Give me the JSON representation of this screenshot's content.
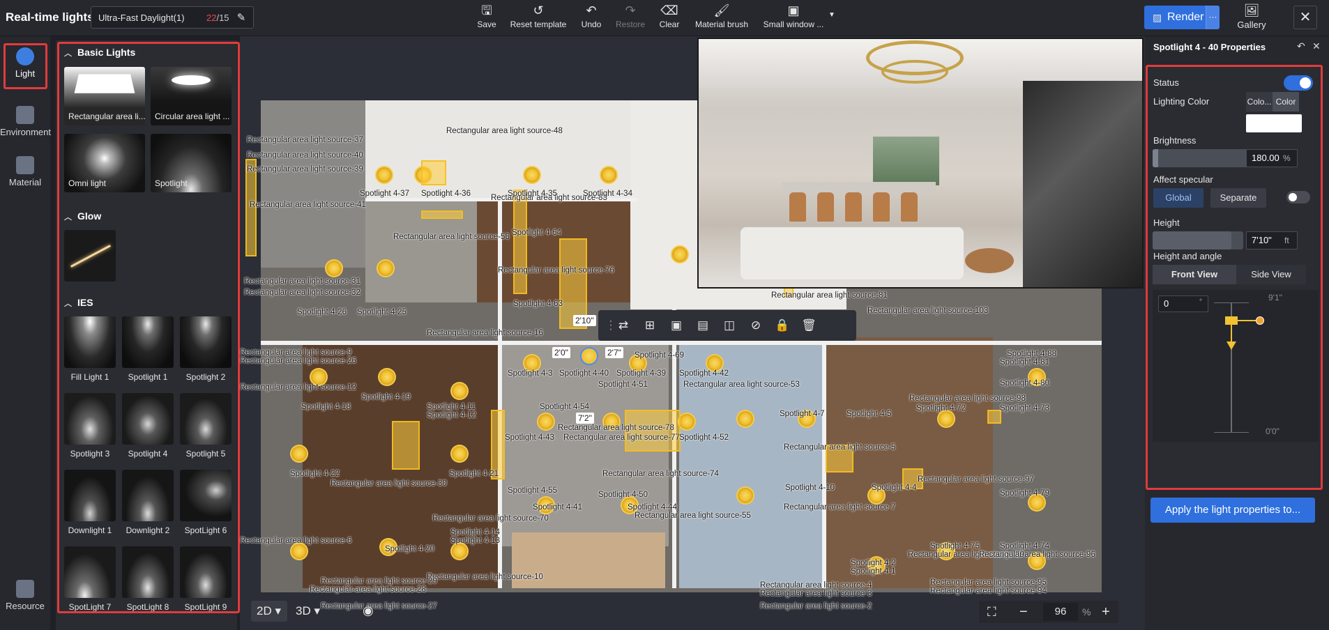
{
  "app": {
    "title": "Real-time lights"
  },
  "template": {
    "name": "Ultra-Fast Daylight(1)",
    "count_current": "22",
    "count_total": "/15"
  },
  "toolbar": {
    "save": "Save",
    "reset": "Reset template",
    "undo": "Undo",
    "restore": "Restore",
    "clear": "Clear",
    "brush": "Material brush",
    "small_window": "Small window ..."
  },
  "render": {
    "label": "Render",
    "more": "···"
  },
  "gallery": {
    "label": "Gallery"
  },
  "leftnav": {
    "light": "Light",
    "environment": "Environment",
    "material": "Material",
    "resource": "Resource"
  },
  "library": {
    "basic_title": "Basic Lights",
    "basic": [
      "Rectangular area li...",
      "Circular area light ...",
      "Omni light",
      "Spotlight"
    ],
    "glow_title": "Glow",
    "ies_title": "IES",
    "ies": [
      "Fill Light 1",
      "Spotlight 1",
      "Spotlight 2",
      "Spotlight 3",
      "Spotlight 4",
      "Spotlight 5",
      "Downlight 1",
      "Downlight 2",
      "SpotLight 6",
      "SpotLight 7",
      "SpotLight 8",
      "SpotLight 9"
    ]
  },
  "plan_labels": [
    "Rectangular area light source-37",
    "Rectangular area light source-40",
    "Rectangular area light source-39",
    "Rectangular area light source-41",
    "Rectangular area light source-48",
    "Rectangular area light source-83",
    "Spotlight 4-37",
    "Spotlight 4-36",
    "Spotlight 4-35",
    "Spotlight 4-34",
    "Spotlight 4-64",
    "Rectangular area light source-56",
    "Rectangular area light source-76",
    "Rectangular area light source-31",
    "Rectangular area light source-32",
    "Spotlight 4-26",
    "Spotlight 4-25",
    "Spotlight 4-63",
    "Rectangular area light source-16",
    "Rectangular area light source-81",
    "Rectangular area light source-103",
    "Rectangular area light source-9",
    "Rectangular area light source-26",
    "Rectangular area light source-12",
    "Spotlight 4-19",
    "Spotlight 4-18",
    "Spotlight 4-11",
    "Spotlight 4-12",
    "Spotlight 4-3",
    "Spotlight 4-40",
    "Spotlight 4-39",
    "Spotlight 4-42",
    "Spotlight 4-69",
    "Spotlight 4-51",
    "Spotlight 4-54",
    "Rectangular area light source-53",
    "Rectangular area light source-78",
    "Rectangular area light source-77",
    "Spotlight 4-52",
    "Spotlight 4-43",
    "Spotlight 4-7",
    "Spotlight 4-5",
    "Spotlight 4-72",
    "Spotlight 4-73",
    "Spotlight 4-81",
    "Spotlight 4-80",
    "Spotlight 4-88",
    "Rectangular area light source-98",
    "Rectangular area light source-5",
    "Spotlight 4-22",
    "Spotlight 4-21",
    "Rectangular area light source-30",
    "Rectangular area light source-74",
    "Spotlight 4-10",
    "Spotlight 4-4",
    "Spotlight 4-55",
    "Spotlight 4-50",
    "Spotlight 4-41",
    "Spotlight 4-44",
    "Rectangular area light source-55",
    "Rectangular area light source-7",
    "Rectangular area light source-97",
    "Spotlight 4-79",
    "Rectangular area light source-70",
    "Spotlight 4-14",
    "Spotlight 4-13",
    "Rectangular area light source-6",
    "Spotlight 4-20",
    "Rectangular area light source-10",
    "Rectangular area light source-29",
    "Rectangular area light source-28",
    "Rectangular area light source-27",
    "Spotlight 4-2",
    "Spotlight 4-1",
    "Rectangular area light source-4",
    "Rectangular area light source-3",
    "Rectangular area light source-2",
    "Spotlight 4-75",
    "Spotlight 4-74",
    "Rectangular area light source-99",
    "Rectangular area light source-96",
    "Rectangular area light source-95",
    "Rectangular area light source-94"
  ],
  "dimensions": {
    "top": "2'10\"",
    "left": "2'0\"",
    "right": "2'7\"",
    "bottom": "7'2\""
  },
  "view": {
    "mode_2d": "2D",
    "mode_3d": "3D",
    "zoom": "96",
    "zoom_unit": "%"
  },
  "properties": {
    "title": "Spotlight 4 - 40 Properties",
    "status_label": "Status",
    "status_on": true,
    "lighting_color_label": "Lighting Color",
    "color_tab_1": "Colo...",
    "color_tab_2": "Color",
    "color_value": "#ffffff",
    "brightness_label": "Brightness",
    "brightness_value": "180.00",
    "brightness_unit": "%",
    "brightness_level": 0.05,
    "specular_label": "Affect specular",
    "specular_global": "Global",
    "specular_separate": "Separate",
    "specular_toggle_on": false,
    "height_label": "Height",
    "height_value": "7'10\"",
    "height_unit": "ft",
    "height_level": 0.87,
    "angle_label": "Height and angle",
    "front_view": "Front View",
    "side_view": "Side View",
    "angle_value": "0",
    "angle_unit": "°",
    "scale_top": "9'1\"",
    "scale_bottom": "0'0\""
  },
  "apply_button": "Apply the light properties to...",
  "colors": {
    "accent": "#2f6fde",
    "highlight": "#e23b3b",
    "light_marker": "#f1c232"
  }
}
